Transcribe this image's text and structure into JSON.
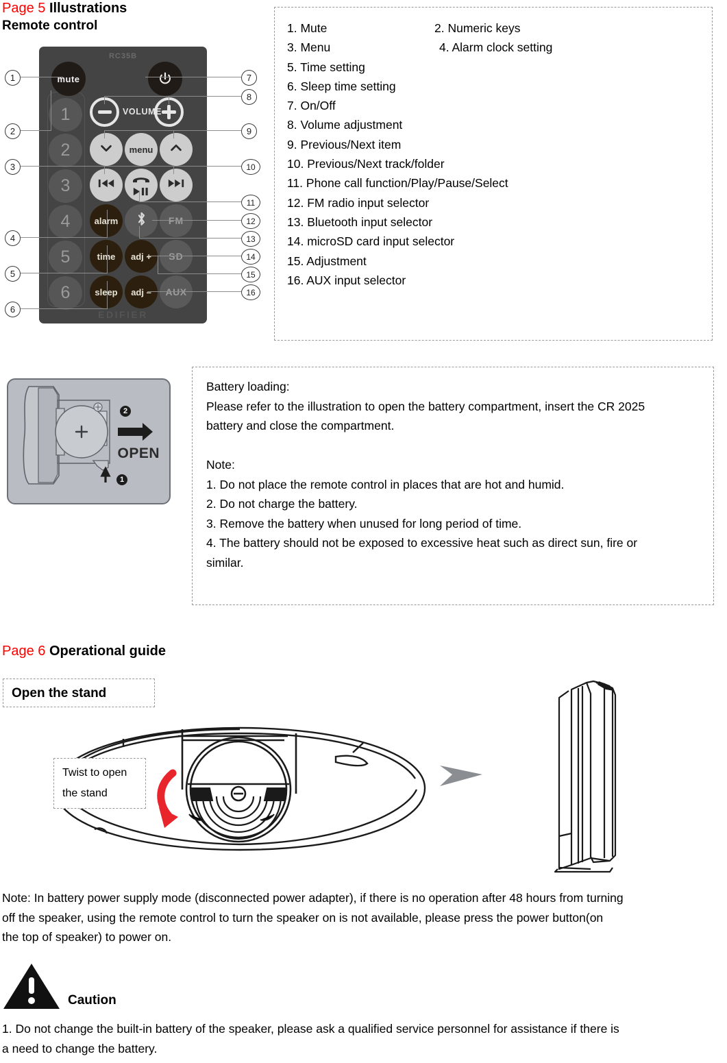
{
  "page5": {
    "page_label": "Page 5",
    "title": "Illustrations",
    "subtitle": "Remote control",
    "remote": {
      "model": "RC35B",
      "brand": "EDIFIER",
      "buttons": {
        "mute": "mute",
        "power": "power-icon",
        "num1": "1",
        "num2": "2",
        "num3": "3",
        "num4": "4",
        "num5": "5",
        "num6": "6",
        "volume_label": "VOLUME",
        "volume_minus": "–",
        "volume_plus": "+",
        "down": "⌄",
        "menu": "menu",
        "up": "⌃",
        "prev": "⏮",
        "play_pause": "▶❙❙",
        "next": "⏭",
        "alarm": "alarm",
        "bluetooth": "bluetooth-icon",
        "fm": "FM",
        "time": "time",
        "adj_plus": "adj +",
        "sd": "SD",
        "sleep": "sleep",
        "adj_minus": "adj –",
        "aux": "AUX"
      }
    },
    "callouts": [
      {
        "n": "1"
      },
      {
        "n": "2"
      },
      {
        "n": "3"
      },
      {
        "n": "4"
      },
      {
        "n": "5"
      },
      {
        "n": "6"
      },
      {
        "n": "7"
      },
      {
        "n": "8"
      },
      {
        "n": "9"
      },
      {
        "n": "10"
      },
      {
        "n": "11"
      },
      {
        "n": "12"
      },
      {
        "n": "13"
      },
      {
        "n": "14"
      },
      {
        "n": "15"
      },
      {
        "n": "16"
      }
    ],
    "legend": {
      "item1": "1. Mute",
      "item2": "2. Numeric keys",
      "item3": "3. Menu",
      "item4": "4. Alarm clock setting",
      "item5": "5. Time setting",
      "item6": "6. Sleep time setting",
      "item7": "7. On/Off",
      "item8": "8. Volume adjustment",
      "item9": "9. Previous/Next item",
      "item10": "10. Previous/Next track/folder",
      "item11": "11. Phone call function/Play/Pause/Select",
      "item12": "12. FM radio input selector",
      "item13": "13. Bluetooth input selector",
      "item14": "14. microSD card input selector",
      "item15": "15. Adjustment",
      "item16": "16. AUX input selector"
    },
    "battery_diagram": {
      "open_label": "OPEN",
      "step1": "1",
      "step2": "2",
      "polarity": "+"
    },
    "battery_text": {
      "heading": "Battery loading:",
      "line1": "Please refer to the illustration to open the battery compartment, insert the CR 2025",
      "line2": "battery and close the compartment.",
      "note_heading": "Note:",
      "note1": "1. Do not place the remote control in places that are hot and humid.",
      "note2": "2. Do not charge the battery.",
      "note3": "3. Remove the battery when unused for long period of time.",
      "note4a": "4. The battery should not be exposed to excessive heat such as direct sun, fire or",
      "note4b": "similar."
    }
  },
  "page6": {
    "page_label": "Page 6",
    "title": "Operational guide",
    "open_stand_box": "Open the stand",
    "twist_line1": "Twist to open",
    "twist_line2": "the stand",
    "note_line1": "Note: In battery power supply mode (disconnected power adapter), if there is no operation after 48 hours from turning",
    "note_line2": "off the speaker, using the remote control to turn the speaker on is not available, please press the power button(on",
    "note_line3": "the top of speaker) to power on.",
    "caution_label": "Caution",
    "caution_line1": "1. Do not change the built-in battery of the speaker, please ask a qualified service personnel for assistance if there is",
    "caution_line2": "a need to change the battery."
  },
  "colors": {
    "page_label": "#ff0000",
    "remote_body": "#444444",
    "accent_red": "#e8252a",
    "arrow_grey": "#8a8d91"
  }
}
